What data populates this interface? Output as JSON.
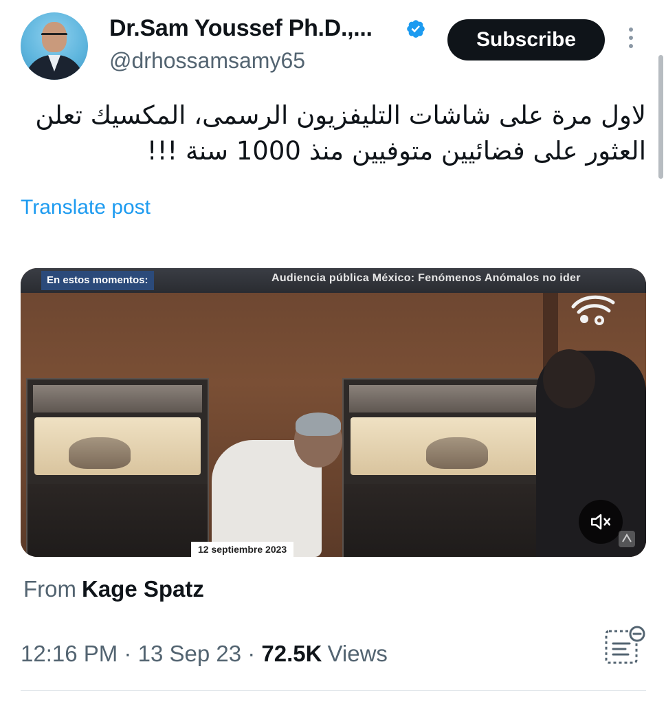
{
  "author": {
    "display_name": "Dr.Sam Youssef Ph.D.,...",
    "handle": "@drhossamsamy65",
    "verified_color": "#1d9bf0"
  },
  "actions": {
    "subscribe_label": "Subscribe"
  },
  "post": {
    "text": "لاول مرة على شاشات التليفزيون الرسمى، المكسيك تعلن\nالعثور على فضائيين متوفيين منذ 1000 سنة !!!",
    "translate_label": "Translate post"
  },
  "video": {
    "banner_left": "En estos momentos:",
    "banner_right": "Audiencia pública México: Fenómenos Anómalos no ider",
    "date_tag": "12 septiembre 2023",
    "mute_icon": "volume-muted-icon"
  },
  "source": {
    "prefix": "From",
    "name": "Kage Spatz"
  },
  "meta": {
    "time": "12:16 PM",
    "date": "13 Sep 23",
    "views_count": "72.5K",
    "views_label": "Views",
    "separator": "·"
  },
  "colors": {
    "accent": "#1d9bf0",
    "text_primary": "#0f1419",
    "text_secondary": "#536471"
  }
}
